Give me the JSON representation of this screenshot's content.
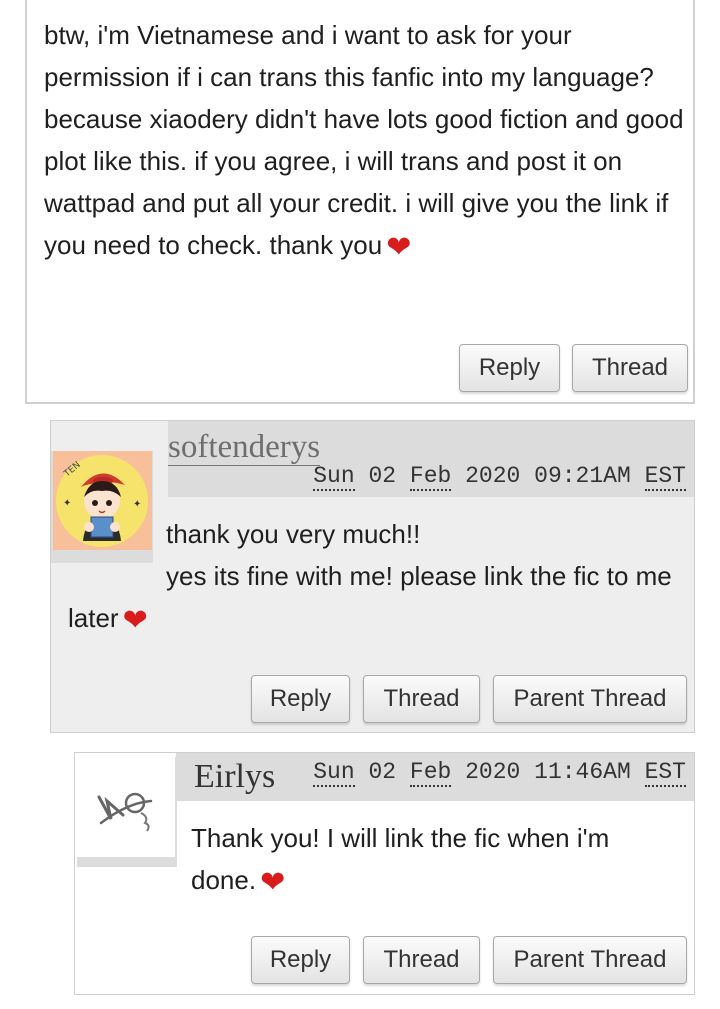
{
  "comments": [
    {
      "body_text": "btw, i'm Vietnamese and i want to ask for your permission if i can trans this fanfic into my language? because xiaodery didn't have lots good fiction and good plot like this. if you agree, i will trans and post it on wattpad and put all your credit. i will give you the link if you need to check. thank you",
      "buttons": {
        "reply": "Reply",
        "thread": "Thread"
      }
    },
    {
      "author": "softenderys",
      "posted": {
        "day": "Sun",
        "date": "02",
        "month": "Feb",
        "year_time": "2020 09:21AM",
        "tz": "EST"
      },
      "body_line1": "thank you very much!!",
      "body_line2": "yes its fine with me! please link the fic to me later",
      "buttons": {
        "reply": "Reply",
        "thread": "Thread",
        "parent": "Parent Thread"
      }
    },
    {
      "author": "Eirlys",
      "posted": {
        "day": "Sun",
        "date": "02",
        "month": "Feb",
        "year_time": "2020 11:46AM",
        "tz": "EST"
      },
      "body_text": "Thank you! I will link the fic when i'm done.",
      "buttons": {
        "reply": "Reply",
        "thread": "Thread",
        "parent": "Parent Thread"
      }
    }
  ],
  "icons": {
    "heart": "heart-emoji",
    "avatar_softenderys": "cartoon-avatar-icon",
    "avatar_eirlys": "signature-avatar-icon"
  },
  "colors": {
    "heart": "#d81b1b",
    "header_bg": "#dcdcdc",
    "comment_bg": "#eeeeee"
  },
  "heart_glyph": "❤",
  "avatar_label": "TEN"
}
